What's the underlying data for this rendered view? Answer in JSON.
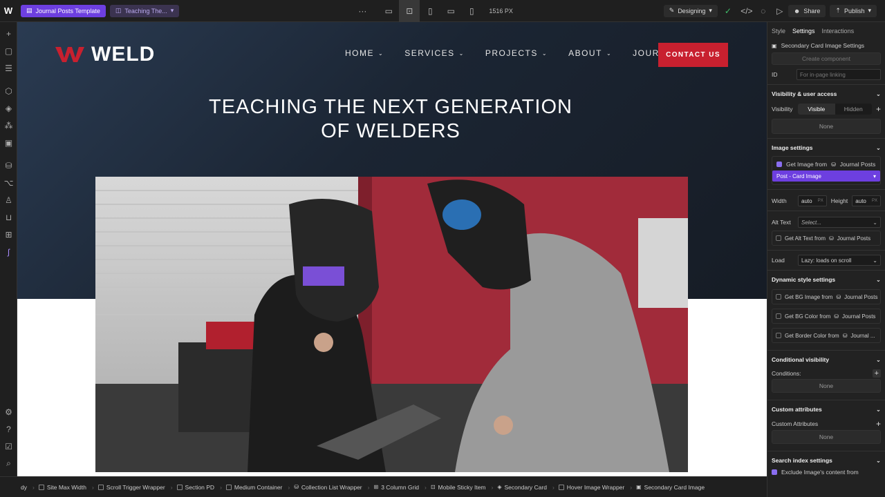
{
  "topbar": {
    "page_label": "Journal Posts Template",
    "collection_item": "Teaching The...",
    "width_readout": "1516 PX",
    "mode": "Designing",
    "share": "Share",
    "publish": "Publish"
  },
  "site": {
    "brand": "WELD",
    "nav": [
      "HOME",
      "SERVICES",
      "PROJECTS",
      "ABOUT",
      "JOURNAL"
    ],
    "cta": "CONTACT US",
    "hero_title": "TEACHING THE NEXT GENERATION\nOF WELDERS"
  },
  "panel": {
    "tabs": [
      "Style",
      "Settings",
      "Interactions"
    ],
    "element": "Secondary Card Image Settings",
    "create_component": "Create component",
    "id_label": "ID",
    "id_placeholder": "For in-page linking",
    "visibility_head": "Visibility & user access",
    "visibility_label": "Visibility",
    "visible": "Visible",
    "hidden": "Hidden",
    "none": "None",
    "image_head": "Image settings",
    "get_image_from": "Get Image from",
    "journal_posts": "Journal Posts",
    "post_card_image": "Post - Card Image",
    "width_label": "Width",
    "height_label": "Height",
    "auto": "auto",
    "px": "PX",
    "alt_label": "Alt Text",
    "alt_select": "Select...",
    "get_alt_from": "Get Alt Text from",
    "load_label": "Load",
    "load_value": "Lazy: loads on scroll",
    "dynamic_head": "Dynamic style settings",
    "get_bg_image": "Get BG Image from",
    "get_bg_color": "Get BG Color from",
    "get_border_color": "Get Border Color from",
    "journal_trunc": "Journal ...",
    "conditional_head": "Conditional visibility",
    "conditions": "Conditions:",
    "custom_head": "Custom attributes",
    "custom_label": "Custom Attributes",
    "search_head": "Search index settings",
    "exclude": "Exclude Image's content from"
  },
  "breadcrumbs": [
    "dy",
    "Site Max Width",
    "Scroll Trigger Wrapper",
    "Section PD",
    "Medium Container",
    "Collection List Wrapper",
    "3 Column Grid",
    "Mobile Sticky Item",
    "Secondary Card",
    "Hover Image Wrapper",
    "Secondary Card Image"
  ],
  "colors": {
    "accent": "#6d3fe0",
    "brand_red": "#c8202f",
    "hero_dark": "#1b2533"
  }
}
